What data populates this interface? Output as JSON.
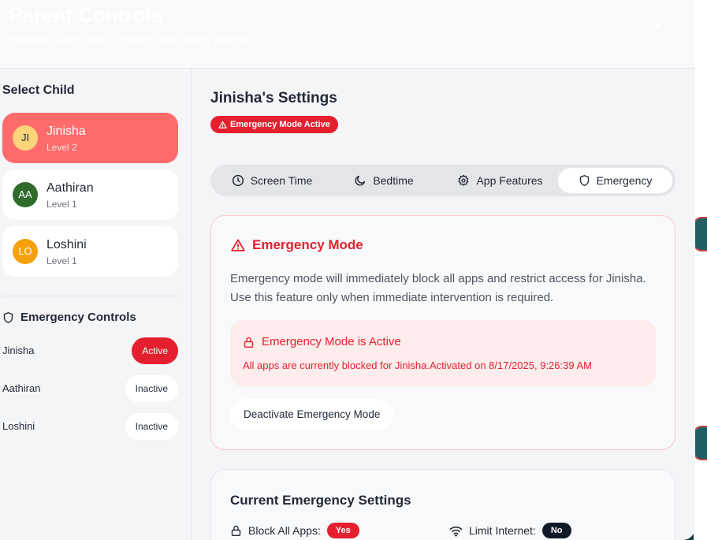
{
  "header": {
    "title": "Parent Controls",
    "subtitle": "Manage screen time, features, and safety settings",
    "close_label": "×"
  },
  "sidebar": {
    "select_child_title": "Select Child",
    "children": [
      {
        "initials": "JI",
        "name": "Jinisha",
        "level": "Level 2",
        "avatar_color": "#fcd47a",
        "initials_color": "#1f2937"
      },
      {
        "initials": "AA",
        "name": "Aathiran",
        "level": "Level 1",
        "avatar_color": "#2f6b2a",
        "initials_color": "#ffffff"
      },
      {
        "initials": "LO",
        "name": "Loshini",
        "level": "Level 1",
        "avatar_color": "#f5a00c",
        "initials_color": "#ffffff"
      }
    ],
    "emergency_controls_title": "Emergency Controls",
    "emergency_rows": [
      {
        "name": "Jinisha",
        "status": "Active"
      },
      {
        "name": "Aathiran",
        "status": "Inactive"
      },
      {
        "name": "Loshini",
        "status": "Inactive"
      }
    ]
  },
  "main": {
    "heading": "Jinisha's Settings",
    "badge": "Emergency Mode Active",
    "tabs": [
      {
        "label": "Screen Time",
        "icon": "clock-icon"
      },
      {
        "label": "Bedtime",
        "icon": "moon-icon"
      },
      {
        "label": "App Features",
        "icon": "gear-icon"
      },
      {
        "label": "Emergency",
        "icon": "shield-icon"
      }
    ],
    "selected_tab": "Emergency",
    "emergency_card": {
      "title": "Emergency Mode",
      "description": "Emergency mode will immediately block all apps and restrict access for Jinisha. Use this feature only when immediate intervention is required.",
      "alert_title": "Emergency Mode is Active",
      "alert_message": "All apps are currently blocked for Jinisha.Activated on 8/17/2025, 9:26:39 AM",
      "deactivate_label": "Deactivate Emergency Mode"
    },
    "current_settings": {
      "title": "Current Emergency Settings",
      "items": [
        {
          "label": "Block All Apps:",
          "value": "Yes",
          "icon": "lock-icon"
        },
        {
          "label": "Limit Internet:",
          "value": "No",
          "icon": "wifi-icon"
        }
      ]
    }
  },
  "colors": {
    "accent": "#e5202e",
    "selected_child": "#ff6b6b"
  }
}
